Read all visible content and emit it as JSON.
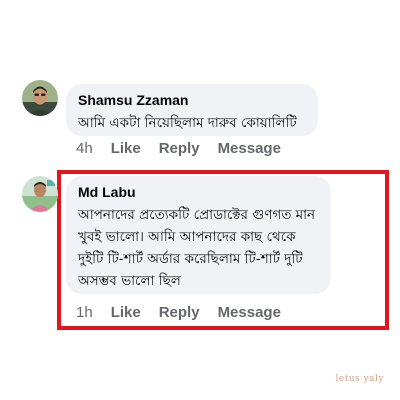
{
  "comments": [
    {
      "author": "Shamsu Zzaman",
      "text": "আমি একটা নিয়েছিলাম দারুব কোয়ালিটি",
      "time": "4h",
      "like_label": "Like",
      "reply_label": "Reply",
      "message_label": "Message"
    },
    {
      "author": "Md Labu",
      "text_lines": [
        "আপনাদের প্রত্যেকটি প্রোডাক্টের গুণগত মান",
        "খুবই ভালো। আমি আপনাদের কাছ থেকে",
        "দুইটি টি-শার্ট অর্ডার করেছিলাম টি-শার্ট দুটি",
        "অসম্ভব ভালো ছিল"
      ],
      "time": "1h",
      "like_label": "Like",
      "reply_label": "Reply",
      "message_label": "Message"
    }
  ],
  "watermark": "letus yaly",
  "colors": {
    "bubble": "#f0f2f5",
    "highlight_border": "#e0161f",
    "meta_text": "#65676b"
  }
}
